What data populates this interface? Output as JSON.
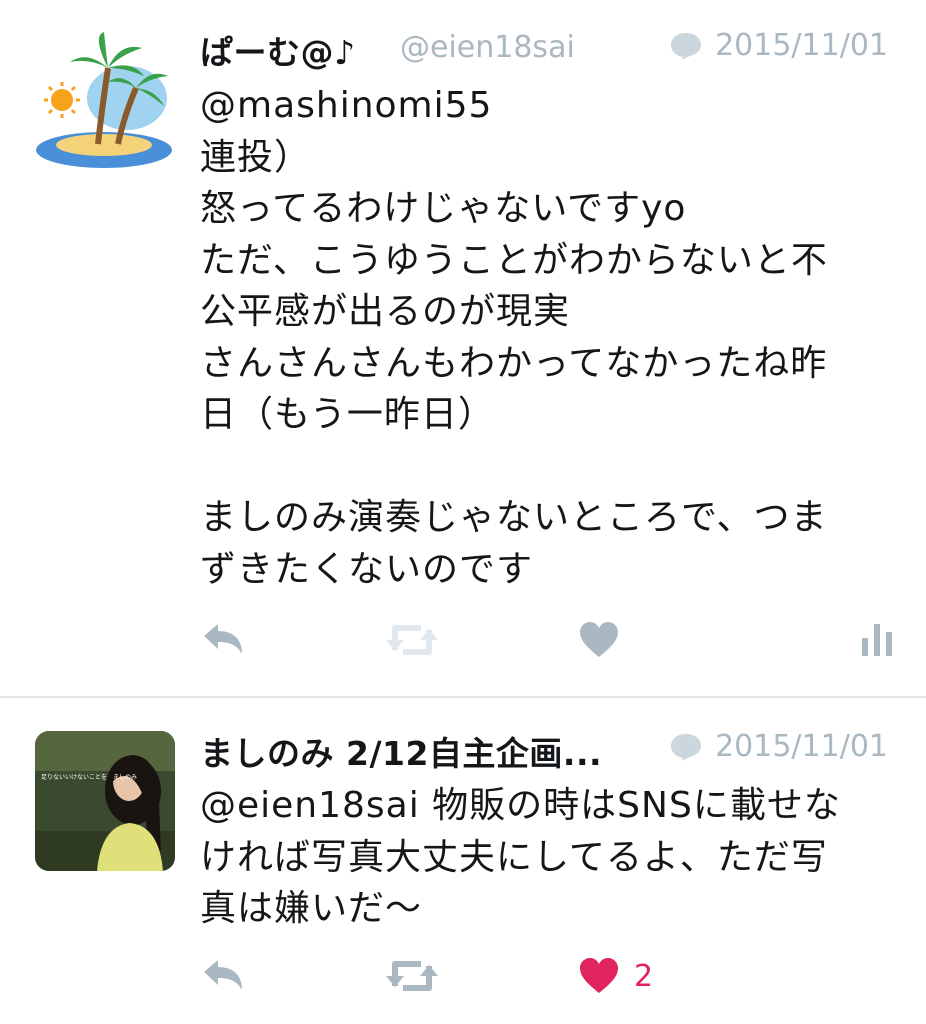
{
  "tweets": [
    {
      "name": "ぱーむ@♪",
      "handle": "@eien18sai",
      "date": "2015/11/01",
      "body": "@mashinomi55\n連投）\n怒ってるわけじゃないですyo\nただ、こうゆうことがわからないと不\n公平感が出るのが現実\nさんさんさんもわかってなかったね昨\n日（もう一昨日）\n\nましのみ演奏じゃないところで、つま\nずきたくないのです",
      "avatar_icon": "palm-island-icon",
      "liked": false,
      "like_count": ""
    },
    {
      "name": "ましのみ 2/12自主企画...",
      "handle": "",
      "date": "2015/11/01",
      "body": "@eien18sai 物販の時はSNSに載せな\nければ写真大丈夫にしてるよ、ただ写\n真は嫌いだ〜",
      "avatar_icon": "user-photo",
      "avatar_caption": "足りないいけないことを　ましのみ",
      "liked": true,
      "like_count": "2"
    }
  ],
  "icons": {
    "reply": "reply-icon",
    "retweet": "retweet-icon",
    "like": "heart-icon",
    "stats": "analytics-icon",
    "reply_indicator": "speech-bubble-icon"
  },
  "colors": {
    "icon_gray": "#aab8c2",
    "like_red": "#e0245e",
    "text": "#14171a",
    "divider": "#e1e8ed"
  }
}
